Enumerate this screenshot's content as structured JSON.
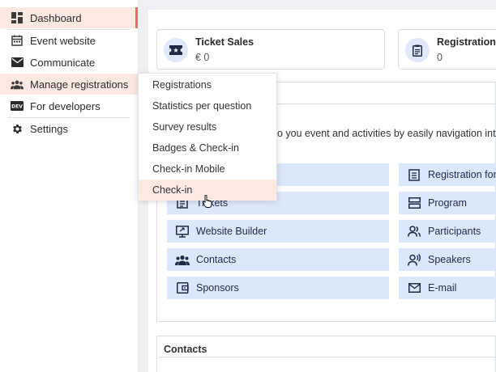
{
  "sidebar": {
    "items": [
      {
        "label": "Dashboard",
        "icon": "dashboard-icon"
      },
      {
        "label": "Event website",
        "icon": "calendar-icon"
      },
      {
        "label": "Communicate",
        "icon": "mail-icon"
      },
      {
        "label": "Manage registrations",
        "icon": "people-icon"
      },
      {
        "label": "For developers",
        "icon": "dev-icon"
      },
      {
        "label": "Settings",
        "icon": "gear-icon"
      }
    ]
  },
  "stats": [
    {
      "title": "Ticket Sales",
      "value": "€ 0",
      "icon": "ticket-icon"
    },
    {
      "title": "Registrations",
      "value": "0",
      "icon": "clipboard-icon"
    }
  ],
  "intro_text": "o you event and activities by easily navigation int",
  "tiles_left": [
    {
      "label": "",
      "icon": ""
    },
    {
      "label": "Tickets",
      "icon": "ticket-list-icon"
    },
    {
      "label": "Website Builder",
      "icon": "monitor-icon"
    },
    {
      "label": "Contacts",
      "icon": "contacts-icon"
    },
    {
      "label": "Sponsors",
      "icon": "wallet-icon"
    }
  ],
  "tiles_right": [
    {
      "label": "Registration for",
      "icon": "form-icon"
    },
    {
      "label": "Program",
      "icon": "program-icon"
    },
    {
      "label": "Participants",
      "icon": "participants-icon"
    },
    {
      "label": "Speakers",
      "icon": "speaker-icon"
    },
    {
      "label": "E-mail",
      "icon": "mail-icon"
    }
  ],
  "contacts_title": "Contacts",
  "dropdown": {
    "items": [
      "Registrations",
      "Statistics per question",
      "Survey results",
      "Badges & Check-in",
      "Check-in Mobile",
      "Check-in"
    ]
  },
  "colors": {
    "accent": "#f26b4a",
    "highlight": "#fde8e2",
    "tile": "#dbe7fb",
    "text": "#1f2a44"
  }
}
